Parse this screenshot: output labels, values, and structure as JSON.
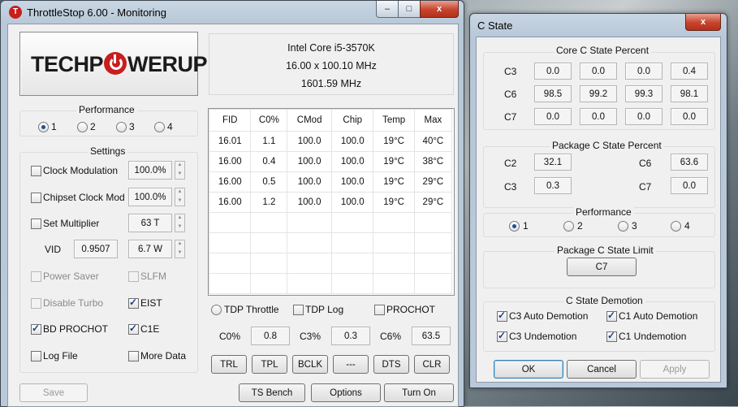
{
  "main_window": {
    "title": "ThrottleStop 6.00 - Monitoring",
    "controls": {
      "minimize": "–",
      "maximize": "□",
      "close": "x"
    },
    "logo": {
      "text_before": "TECHP",
      "text_after": "WERUP"
    },
    "cpu": {
      "name": "Intel Core i5-3570K",
      "multiplier_line": "16.00 x 100.10 MHz",
      "freq_line": "1601.59 MHz"
    },
    "performance": {
      "label": "Performance",
      "options": [
        "1",
        "2",
        "3",
        "4"
      ],
      "selected": 0
    },
    "settings": {
      "label": "Settings",
      "clock_modulation": {
        "label": "Clock Modulation",
        "value": "100.0%"
      },
      "chipset_clock_mod": {
        "label": "Chipset Clock Mod",
        "value": "100.0%"
      },
      "set_multiplier": {
        "label": "Set Multiplier",
        "value": "63 T"
      },
      "vid": {
        "label": "VID",
        "value": "0.9507",
        "power": "6.7 W"
      },
      "power_saver": "Power Saver",
      "slfm": "SLFM",
      "disable_turbo": "Disable Turbo",
      "eist": "EIST",
      "bd_prochot": "BD PROCHOT",
      "c1e": "C1E",
      "log_file": "Log File",
      "more_data": "More Data"
    },
    "table": {
      "headers": [
        "FID",
        "C0%",
        "CMod",
        "Chip",
        "Temp",
        "Max"
      ],
      "rows": [
        [
          "16.01",
          "1.1",
          "100.0",
          "100.0",
          "19°C",
          "40°C"
        ],
        [
          "16.00",
          "0.4",
          "100.0",
          "100.0",
          "19°C",
          "38°C"
        ],
        [
          "16.00",
          "0.5",
          "100.0",
          "100.0",
          "19°C",
          "29°C"
        ],
        [
          "16.00",
          "1.2",
          "100.0",
          "100.0",
          "19°C",
          "29°C"
        ]
      ]
    },
    "options_row": {
      "tdp_throttle": "TDP Throttle",
      "tdp_log": "TDP Log",
      "prochot": "PROCHOT"
    },
    "cstates": {
      "c0_label": "C0%",
      "c0_value": "0.8",
      "c3_label": "C3%",
      "c3_value": "0.3",
      "c6_label": "C6%",
      "c6_value": "63.5"
    },
    "bottom_buttons": [
      "TRL",
      "TPL",
      "BCLK",
      "---",
      "DTS",
      "CLR"
    ],
    "save": "Save",
    "ts_bench": "TS Bench",
    "options": "Options",
    "turn_on": "Turn On"
  },
  "cstate_window": {
    "title": "C State",
    "close": "x",
    "core": {
      "label": "Core C State Percent",
      "rows": [
        {
          "name": "C3",
          "values": [
            "0.0",
            "0.0",
            "0.0",
            "0.4"
          ]
        },
        {
          "name": "C6",
          "values": [
            "98.5",
            "99.2",
            "99.3",
            "98.1"
          ]
        },
        {
          "name": "C7",
          "values": [
            "0.0",
            "0.0",
            "0.0",
            "0.0"
          ]
        }
      ]
    },
    "package": {
      "label": "Package C State Percent",
      "c2_label": "C2",
      "c2_value": "32.1",
      "c6_label": "C6",
      "c6_value": "63.6",
      "c3_label": "C3",
      "c3_value": "0.3",
      "c7_label": "C7",
      "c7_value": "0.0"
    },
    "performance": {
      "label": "Performance",
      "options": [
        "1",
        "2",
        "3",
        "4"
      ],
      "selected": 0
    },
    "limit": {
      "label": "Package C State Limit",
      "value": "C7"
    },
    "demotion": {
      "label": "C State Demotion",
      "c3_auto": "C3 Auto Demotion",
      "c1_auto": "C1 Auto Demotion",
      "c3_un": "C3 Undemotion",
      "c1_un": "C1 Undemotion"
    },
    "ok": "OK",
    "cancel": "Cancel",
    "apply": "Apply"
  }
}
